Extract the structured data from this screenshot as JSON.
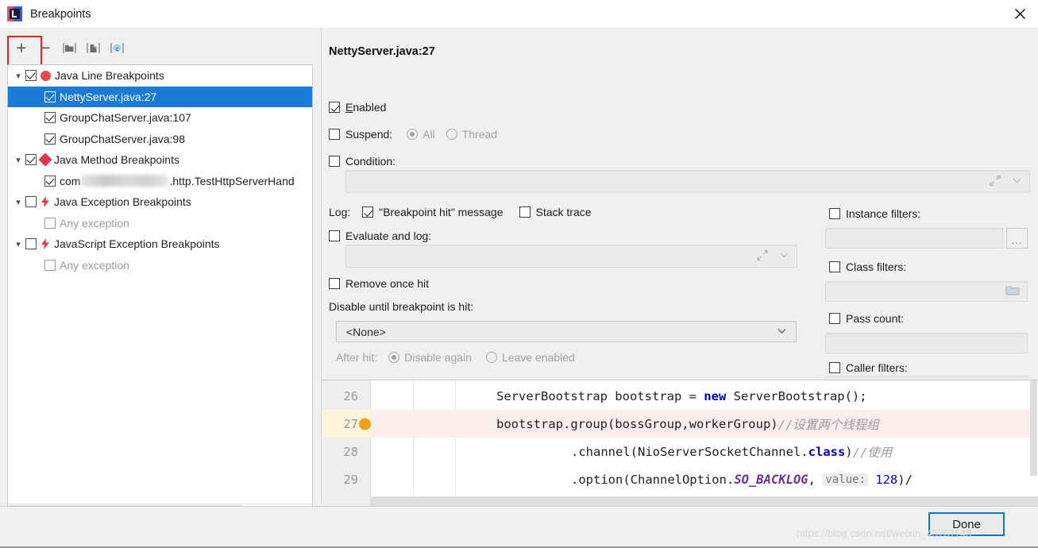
{
  "window": {
    "title": "Breakpoints",
    "app_icon": "intellij-idea-icon",
    "close_icon": "close-icon"
  },
  "toolbar": {
    "add": "+",
    "remove": "−",
    "buttons": [
      {
        "name": "add-breakpoint-button",
        "glyph": "+"
      },
      {
        "name": "remove-breakpoint-button",
        "glyph": "−"
      },
      {
        "name": "mute-breakpoints-button",
        "glyph": "folder-icon"
      },
      {
        "name": "view-source-button",
        "glyph": "file-icon"
      },
      {
        "name": "group-by-class-button",
        "glyph": "c-circle-icon"
      }
    ]
  },
  "tree": {
    "nodes": [
      {
        "label": "Java Line Breakpoints",
        "level": 0,
        "expanded": true,
        "checked": true,
        "icon": "red-dot-icon",
        "dim": false
      },
      {
        "label": "NettyServer.java:27",
        "level": 1,
        "expanded": null,
        "checked": true,
        "icon": "none",
        "dim": false,
        "selected": true
      },
      {
        "label": "GroupChatServer.java:107",
        "level": 1,
        "expanded": null,
        "checked": true,
        "icon": "none",
        "dim": false
      },
      {
        "label": "GroupChatServer.java:98",
        "level": 1,
        "expanded": null,
        "checked": true,
        "icon": "none",
        "dim": false
      },
      {
        "label": "Java Method Breakpoints",
        "level": 0,
        "expanded": true,
        "checked": true,
        "icon": "red-diamond-icon",
        "dim": false
      },
      {
        "label": "com",
        "label_suffix": ".http.TestHttpServerHand",
        "redacted": true,
        "level": 1,
        "expanded": null,
        "checked": true,
        "icon": "none",
        "dim": false
      },
      {
        "label": "Java Exception Breakpoints",
        "level": 0,
        "expanded": true,
        "checked": false,
        "icon": "red-bolt-icon",
        "dim": false
      },
      {
        "label": "Any exception",
        "level": 1,
        "expanded": null,
        "checked": false,
        "icon": "none",
        "dim": true
      },
      {
        "label": "JavaScript Exception Breakpoints",
        "level": 0,
        "expanded": true,
        "checked": false,
        "icon": "red-bolt-icon",
        "dim": false
      },
      {
        "label": "Any exception",
        "level": 1,
        "expanded": null,
        "checked": false,
        "icon": "none",
        "dim": true
      }
    ]
  },
  "help": {
    "glyph": "?"
  },
  "details": {
    "breakpoint_title": "NettyServer.java:27",
    "enabled": {
      "label": "Enabled",
      "checked": true
    },
    "suspend": {
      "label": "Suspend:",
      "checked": false,
      "options": [
        {
          "label": "All",
          "selected": true
        },
        {
          "label": "Thread",
          "selected": false
        }
      ]
    },
    "condition": {
      "label": "Condition:",
      "checked": false,
      "value": ""
    },
    "log": {
      "label": "Log:",
      "breakpoint_hit_message": {
        "label": "\"Breakpoint hit\" message",
        "checked": true
      },
      "stack_trace": {
        "label": "Stack trace",
        "checked": false
      }
    },
    "evaluate_and_log": {
      "label": "Evaluate and log:",
      "checked": false,
      "value": ""
    },
    "remove_once_hit": {
      "label": "Remove once hit",
      "checked": false
    },
    "disable_until": {
      "label": "Disable until breakpoint is hit:",
      "value": "<None>"
    },
    "after_hit": {
      "label": "After hit:",
      "options": [
        {
          "label": "Disable again",
          "selected": true
        },
        {
          "label": "Leave enabled",
          "selected": false
        }
      ]
    },
    "filters": {
      "instance": {
        "label": "Instance filters:",
        "checked": false,
        "value": "",
        "button": "..."
      },
      "class": {
        "label": "Class filters:",
        "checked": false,
        "value": "",
        "icon": "folder-icon"
      },
      "pass_count": {
        "label": "Pass count:",
        "checked": false,
        "value": ""
      },
      "caller": {
        "label": "Caller filters:",
        "checked": false,
        "value": "",
        "icon": "folder-icon"
      }
    }
  },
  "code_preview": {
    "lines": [
      {
        "number": "26",
        "highlighted": false,
        "has_breakpoint": false,
        "indent": 220,
        "tokens": [
          {
            "text": "ServerBootstrap bootstrap = ",
            "style": "plain"
          },
          {
            "text": "new",
            "style": "kw"
          },
          {
            "text": " ServerBootstrap();",
            "style": "plain"
          }
        ]
      },
      {
        "number": "27",
        "highlighted": true,
        "has_breakpoint": true,
        "indent": 220,
        "tokens": [
          {
            "text": "bootstrap.group(bossGroup,workerGroup)",
            "style": "plain"
          },
          {
            "text": "//设置两个线程组",
            "style": "cm"
          }
        ]
      },
      {
        "number": "28",
        "highlighted": false,
        "has_breakpoint": false,
        "indent": 314,
        "tokens": [
          {
            "text": ".channel(NioServerSocketChannel.",
            "style": "plain"
          },
          {
            "text": "class",
            "style": "kw"
          },
          {
            "text": ")",
            "style": "plain"
          },
          {
            "text": "//使用",
            "style": "cm"
          }
        ]
      },
      {
        "number": "29",
        "highlighted": false,
        "has_breakpoint": false,
        "indent": 314,
        "tokens": [
          {
            "text": ".option(ChannelOption.",
            "style": "plain"
          },
          {
            "text": "SO_BACKLOG",
            "style": "st"
          },
          {
            "text": ", ",
            "style": "plain"
          },
          {
            "text": "value:",
            "style": "hint"
          },
          {
            "text": " ",
            "style": "plain"
          },
          {
            "text": "128",
            "style": "num"
          },
          {
            "text": ")/",
            "style": "plain"
          }
        ]
      }
    ]
  },
  "footer": {
    "done_label": "Done",
    "watermark": "https://blog.csdn.net/weixin_45761148"
  },
  "colors": {
    "selection": "#1b7ad4",
    "accent": "#1275c8",
    "breakpoint_red": "#e64b4b",
    "breakpoint_marker": "#eda21a",
    "highlight_red": "#ee1b22"
  }
}
